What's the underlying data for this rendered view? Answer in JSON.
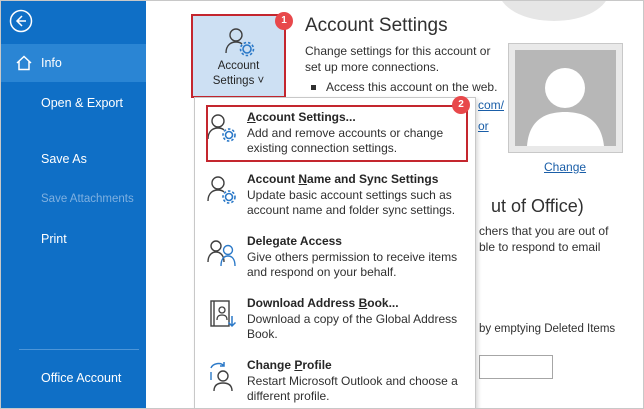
{
  "sidebar": {
    "items": [
      {
        "label": "Info",
        "state": "active"
      },
      {
        "label": "Open & Export",
        "state": "normal"
      },
      {
        "label": "Save As",
        "state": "normal"
      },
      {
        "label": "Save Attachments",
        "state": "disabled"
      },
      {
        "label": "Print",
        "state": "normal"
      },
      {
        "label": "Office Account",
        "state": "normal"
      }
    ]
  },
  "account_button": {
    "line1": "Account",
    "line2": "Settings ˅",
    "icon": "account-settings-icon"
  },
  "badges": [
    "1",
    "2"
  ],
  "section": {
    "title": "Account Settings",
    "description": "Change settings for this account or set up more connections.",
    "bullet": "Access this account on the web.",
    "partial_link_1": "com/",
    "partial_link_2": "or"
  },
  "profile": {
    "change_label": "Change"
  },
  "out_of_office": {
    "title": "ut of Office)",
    "line1": "chers that you are out of",
    "line2": "ble to respond to email"
  },
  "mailbox": {
    "text": "by emptying Deleted Items"
  },
  "dropdown": {
    "items": [
      {
        "title_pre": "",
        "title_u": "A",
        "title_post": "ccount Settings...",
        "description": "Add and remove accounts or change existing connection settings.",
        "icon": "account-gear-icon"
      },
      {
        "title_pre": "Account ",
        "title_u": "N",
        "title_post": "ame and Sync Settings",
        "description": "Update basic account settings such as account name and folder sync settings.",
        "icon": "account-sync-icon"
      },
      {
        "title_pre": "Dele",
        "title_u": "g",
        "title_post": "ate Access",
        "description": "Give others permission to receive items and respond on your behalf.",
        "icon": "delegate-icon"
      },
      {
        "title_pre": "Download Address ",
        "title_u": "B",
        "title_post": "ook...",
        "description": "Download a copy of the Global Address Book.",
        "icon": "address-book-icon"
      },
      {
        "title_pre": "Change ",
        "title_u": "P",
        "title_post": "rofile",
        "description": "Restart Microsoft Outlook and choose a different profile.",
        "icon": "change-profile-icon"
      }
    ]
  },
  "colors": {
    "sidebar": "#0f6fc6",
    "sidebar_active": "#2a85d4",
    "highlight_red": "#c4262e",
    "button_bg": "#cde0f3",
    "link": "#1a5ea8"
  }
}
